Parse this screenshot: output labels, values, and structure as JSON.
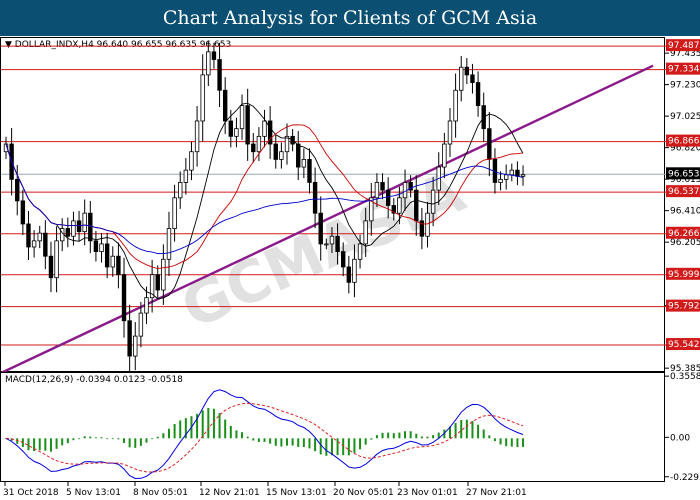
{
  "banner_title": "Chart Analysis for Clients of GCM Asia",
  "chart_data": {
    "type": "candlestick",
    "symbol_header": "DOLLAR_INDX,H4  96.640 96.655 96.635 96.653",
    "x_tick_labels": [
      "31 Oct 2018",
      "5 Nov 13:01",
      "8 Nov 05:01",
      "12 Nov 21:01",
      "15 Nov 13:01",
      "20 Nov 05:01",
      "23 Nov 01:01",
      "27 Nov 21:01"
    ],
    "y_tick_labels": [
      "97.435",
      "97.230",
      "97.025",
      "96.820",
      "96.615",
      "96.410",
      "96.205",
      "95.792",
      "95.385"
    ],
    "ylim": [
      95.36,
      97.54
    ],
    "current_price": "96.653",
    "horizontal_levels": [
      "97.487",
      "97.334",
      "96.866",
      "96.537",
      "96.266",
      "95.999",
      "95.792",
      "95.542"
    ],
    "close_series": [
      96.85,
      96.62,
      96.48,
      96.33,
      96.18,
      96.22,
      96.27,
      96.12,
      95.98,
      96.22,
      96.3,
      96.25,
      96.35,
      96.28,
      96.4,
      96.22,
      96.15,
      96.2,
      96.05,
      96.12,
      96.0,
      95.7,
      95.47,
      95.6,
      95.75,
      95.85,
      96.0,
      95.9,
      96.1,
      96.3,
      96.5,
      96.6,
      96.68,
      96.8,
      97.0,
      97.3,
      97.45,
      97.4,
      97.2,
      97.0,
      96.9,
      96.95,
      97.1,
      96.85,
      96.8,
      96.9,
      97.0,
      96.85,
      96.75,
      96.8,
      96.9,
      96.85,
      96.7,
      96.75,
      96.6,
      96.4,
      96.2,
      96.2,
      96.25,
      96.15,
      96.05,
      95.95,
      96.1,
      96.2,
      96.35,
      96.5,
      96.6,
      96.55,
      96.45,
      96.4,
      96.5,
      96.6,
      96.55,
      96.35,
      96.25,
      96.4,
      96.55,
      96.7,
      96.85,
      97.0,
      97.2,
      97.35,
      97.3,
      97.25,
      97.1,
      96.95,
      96.75,
      96.6,
      96.62,
      96.65,
      96.68,
      96.64,
      96.65
    ],
    "sma_periods": [
      10,
      20,
      50
    ],
    "trendline": {
      "from": [
        0,
        95.36
      ],
      "to": [
        92,
        96.96
      ]
    },
    "macd": {
      "label": "MACD(12,26,9) -0.0394 0.0123 -0.0518",
      "y_tick_labels": [
        "0.3558",
        "0.00",
        "-0.2295"
      ],
      "ylim": [
        -0.26,
        0.38
      ]
    }
  },
  "colors": {
    "banner": "#0b4f73",
    "candle": "#000000",
    "level": "#d11a1a",
    "trend": "#8b1a8b",
    "sma_fast": "#000000",
    "sma_mid": "#cc0000",
    "sma_slow": "#0000cc",
    "macd_hist": "#1a8f1a",
    "macd_signal": "#dd2222",
    "macd_line": "#0000dd",
    "price_box": "#d11a1a",
    "current_box": "#000000",
    "watermark": "#c9c9c9"
  },
  "watermark_text": "GCMASIA"
}
